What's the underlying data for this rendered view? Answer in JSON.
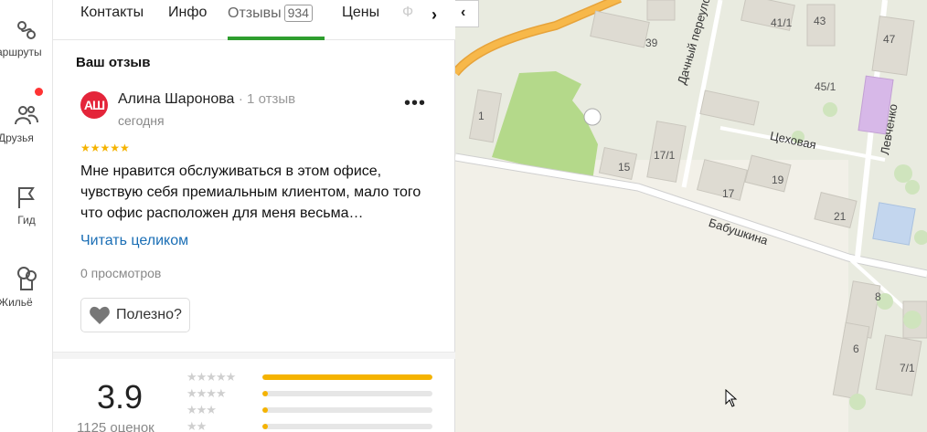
{
  "nav": {
    "items": [
      {
        "label": "аршруты",
        "icon": "routes-icon"
      },
      {
        "label": "Друзья",
        "icon": "friends-icon"
      },
      {
        "label": "Гид",
        "icon": "flag-icon"
      },
      {
        "label": "Жильё",
        "icon": "housing-icon"
      }
    ]
  },
  "tabs": {
    "items": [
      "Контакты",
      "Инфо",
      "Отзывы",
      "Цены",
      "Ф"
    ],
    "reviews_count": "934",
    "active": "Отзывы"
  },
  "review": {
    "section_title": "Ваш отзыв",
    "avatar_initials": "АШ",
    "author": "Алина Шаронова",
    "author_reviews": "· 1 отзыв",
    "date": "сегодня",
    "stars": 5,
    "stars_text": "★★★★★",
    "text": "Мне нравится обслуживаться в этом офисе, чувствую себя премиальным клиентом, мало того что офис расположен для меня весьма…",
    "read_more": "Читать целиком",
    "views": "0 просмотров",
    "helpful_label": "Полезно?",
    "more_label": "•••"
  },
  "summary": {
    "rating": "3.9",
    "count": "1125 оценок",
    "distribution": [
      {
        "stars": "★★★★★",
        "fraction": 1.0
      },
      {
        "stars": "★★★★",
        "fraction": 0.03
      },
      {
        "stars": "★★★",
        "fraction": 0.03
      },
      {
        "stars": "★★",
        "fraction": 0.03
      }
    ]
  },
  "map": {
    "collapse_label": "‹",
    "streets": [
      "Дачный переулок",
      "Цеховая",
      "Бабушкина",
      "Левченко"
    ],
    "house_numbers": [
      "39",
      "41/1",
      "43",
      "47",
      "45/1",
      "1",
      "15",
      "17/1",
      "17",
      "19",
      "21",
      "8",
      "6",
      "7/1"
    ],
    "colors": {
      "road": "#ffffff",
      "highway": "#f7a823",
      "park": "#b4d98a",
      "building": "#e0ddd4",
      "purple_building": "#d7b8e8",
      "blue_building": "#c3d6ee"
    }
  }
}
